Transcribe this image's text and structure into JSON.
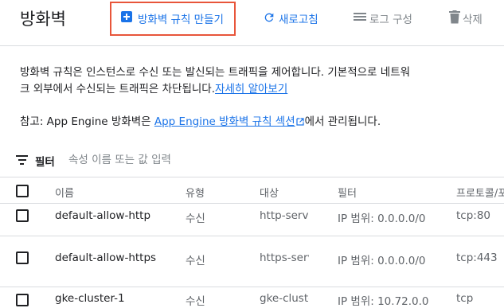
{
  "header": {
    "title": "방화벽",
    "create_rule_label": "방화벽 규칙 만들기",
    "refresh_label": "새로고침",
    "logs_label": "로그 구성",
    "delete_label": "삭제"
  },
  "description": {
    "line1": "방화벽 규칙은 인스턴스로 수신 또는 발신되는 트래픽을 제어합니다. 기본적으로 네트워",
    "line2_text": "크 외부에서 수신되는 트래픽은 차단됩니다.",
    "learn_more": "자세히 알아보기",
    "note_prefix": "참고: App Engine 방화벽은 ",
    "note_link": "App Engine 방화벽 규칙 섹션",
    "note_suffix": "에서 관리됩니다."
  },
  "filter": {
    "label": "필터",
    "placeholder": "속성 이름 또는 값 입력"
  },
  "table": {
    "columns": {
      "name": "이름",
      "type": "유형",
      "target": "대상",
      "filter": "필터",
      "protocol": "프로토콜/포트"
    },
    "rows": [
      {
        "name": "default-allow-http",
        "type": "수신",
        "target": "http-server",
        "filter": "IP 범위: 0.0.0.0/0",
        "protocol": "tcp:80"
      },
      {
        "name": "default-allow-https",
        "type": "수신",
        "target": "https-server",
        "filter": "IP 범위: 0.0.0.0/0",
        "protocol": "tcp:443"
      },
      {
        "name": "gke-cluster-1",
        "type": "수신",
        "target": "gke-cluster",
        "filter": "IP 범위: 10.72.0.0",
        "protocol": "tcp"
      }
    ]
  },
  "colors": {
    "accent": "#1a73e8",
    "highlight_border": "#e8553a",
    "muted": "#80868b"
  }
}
